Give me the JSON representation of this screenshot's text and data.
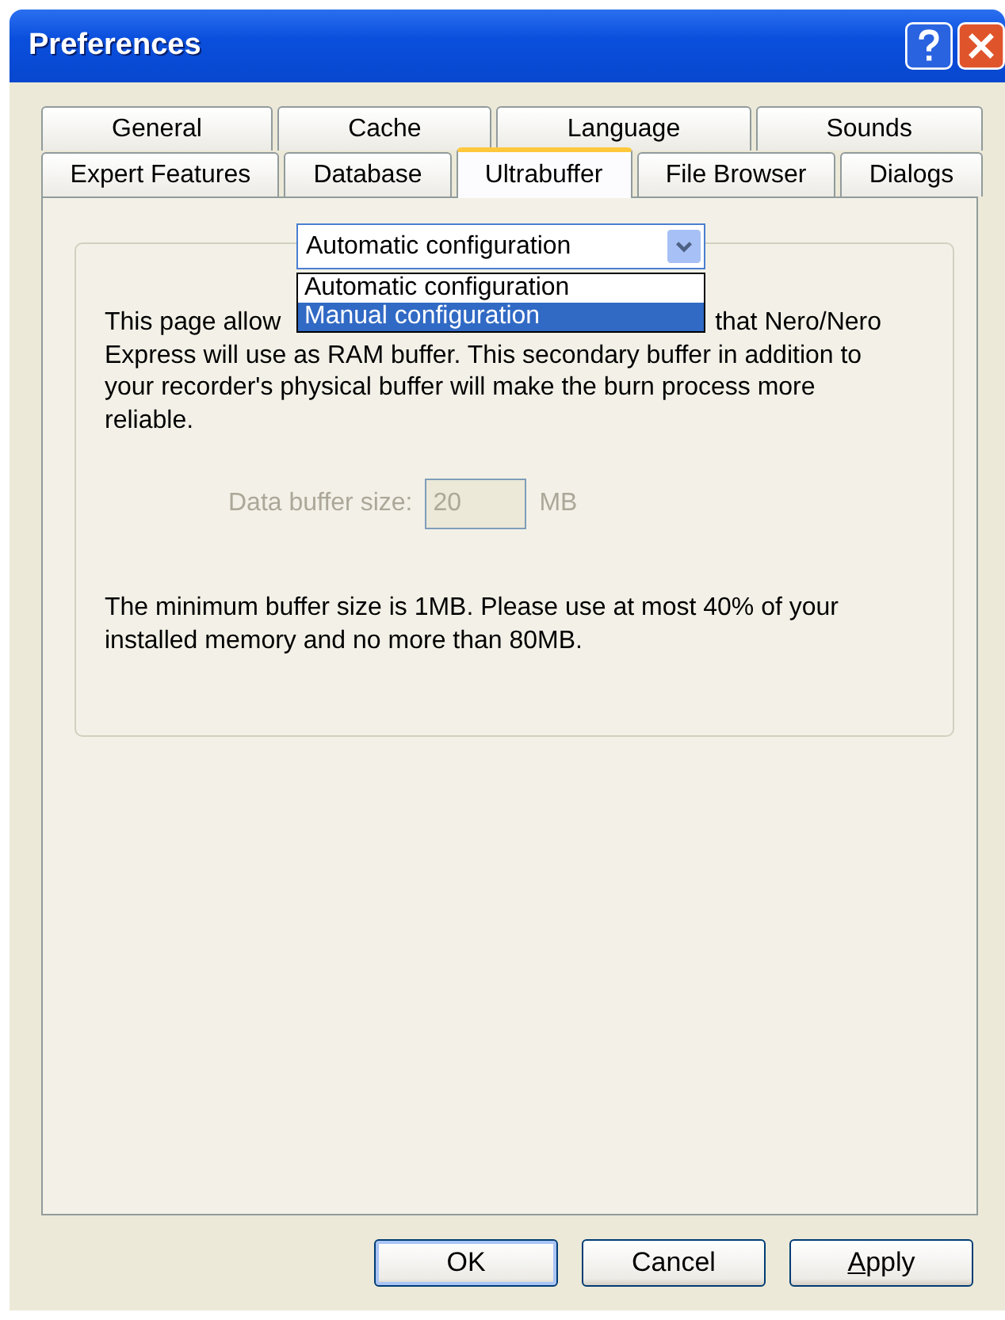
{
  "window": {
    "title": "Preferences"
  },
  "tab_rows": [
    [
      {
        "label": "General",
        "selected": false
      },
      {
        "label": "Cache",
        "selected": false
      },
      {
        "label": "Language",
        "selected": false
      },
      {
        "label": "Sounds",
        "selected": false
      }
    ],
    [
      {
        "label": "Expert Features",
        "selected": false
      },
      {
        "label": "Database",
        "selected": false
      },
      {
        "label": "Ultrabuffer",
        "selected": true
      },
      {
        "label": "File Browser",
        "selected": false
      },
      {
        "label": "Dialogs",
        "selected": false
      }
    ]
  ],
  "config_dropdown": {
    "value": "Automatic configuration",
    "expanded": true,
    "options": [
      {
        "label": "Automatic configuration",
        "selected": true,
        "highlighted": false
      },
      {
        "label": "Manual configuration",
        "selected": false,
        "highlighted": true
      }
    ]
  },
  "description": {
    "line_start": "This page allow",
    "line_end": "that Nero/Nero",
    "rest": "Express will use as RAM buffer. This secondary buffer in addition to your recorder's physical buffer will make the burn process more reliable."
  },
  "buffer_size": {
    "label": "Data buffer size:",
    "value": "20",
    "unit": "MB",
    "disabled": true
  },
  "note": "The minimum buffer size is 1MB. Please use at most 40% of your installed memory and no more than 80MB.",
  "buttons": [
    {
      "label": "OK",
      "kind": "default"
    },
    {
      "label": "Cancel",
      "kind": "normal"
    },
    {
      "label": "Apply",
      "kind": "normal",
      "first_letter_underlined": true
    }
  ]
}
